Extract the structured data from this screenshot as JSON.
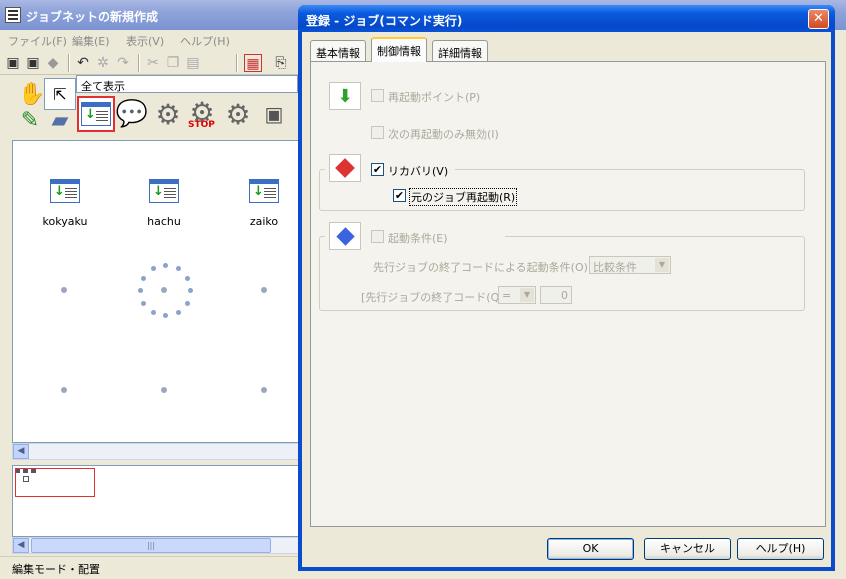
{
  "main": {
    "title": "ジョブネットの新規作成",
    "menu": [
      "ファイル(F)",
      "編集(E)",
      "表示(V)",
      "ヘルプ(H)"
    ],
    "view_select": "全て表示",
    "jobs": [
      "kokyaku",
      "hachu",
      "zaiko"
    ],
    "status": "編集モード・配置"
  },
  "dialog": {
    "title": "登録 - ジョブ(コマンド実行)",
    "close": "✕",
    "tabs": [
      "基本情報",
      "制御情報",
      "詳細情報"
    ],
    "active_tab": "制御情報",
    "restart_point": {
      "label": "再起動ポイント(P)",
      "checked": false,
      "enabled": false
    },
    "restart_only_next": {
      "label": "次の再起動のみ無効(I)",
      "checked": false,
      "enabled": false
    },
    "recovery": {
      "label": "リカバリ(V)",
      "checked": true,
      "enabled": true
    },
    "restart_original": {
      "label": "元のジョブ再起動(R)",
      "checked": true,
      "enabled": true
    },
    "start_condition": {
      "label": "起動条件(E)",
      "checked": false,
      "enabled": false
    },
    "prev_exit_condition_label": "先行ジョブの終了コードによる起動条件(O):",
    "prev_exit_condition_value": "比較条件",
    "prev_exit_code_label": "[先行ジョブの終了コード(Q)]",
    "operator_value": "=",
    "exit_code_value": "0",
    "buttons": {
      "ok": "OK",
      "cancel": "キャンセル",
      "help": "ヘルプ(H)"
    }
  },
  "colors": {
    "titlebar": "#0548c8",
    "highlight": "#e03030",
    "tab_accent": "#ffc83c"
  }
}
